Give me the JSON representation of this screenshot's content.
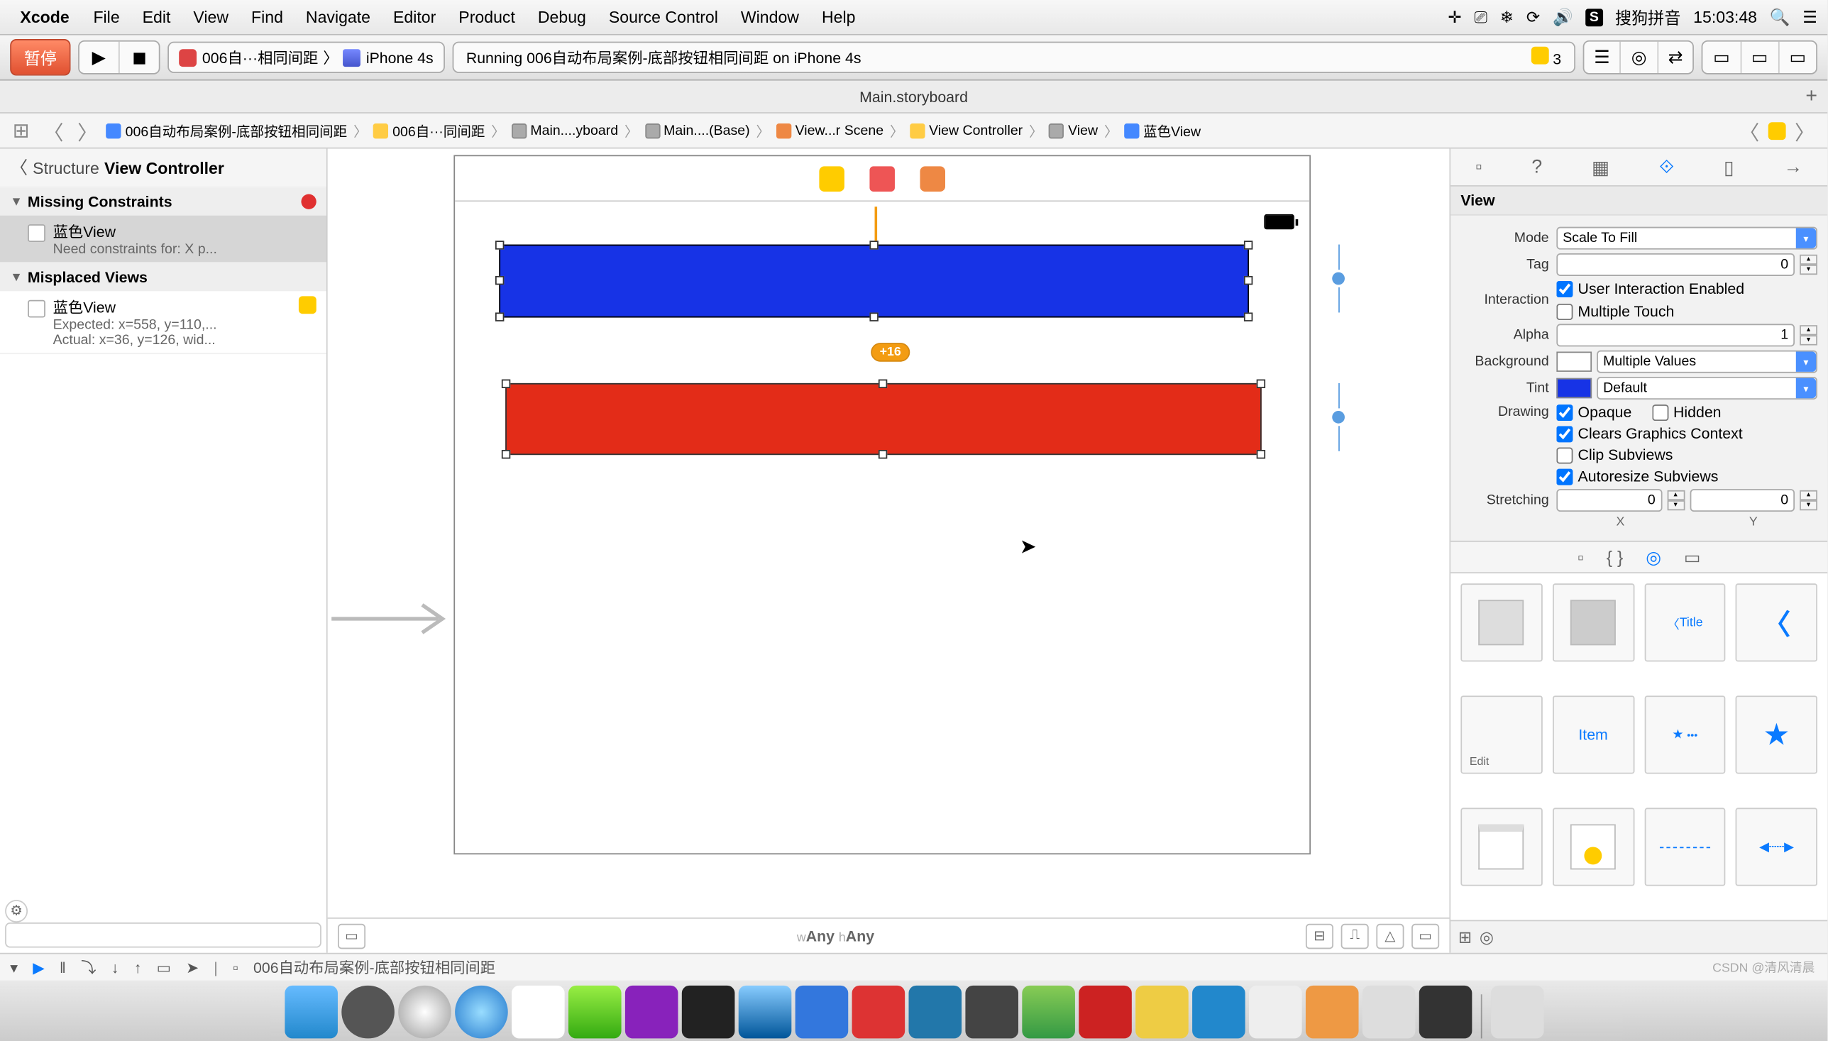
{
  "menubar": {
    "app": "Xcode",
    "items": [
      "File",
      "Edit",
      "View",
      "Find",
      "Navigate",
      "Editor",
      "Product",
      "Debug",
      "Source Control",
      "Window",
      "Help"
    ],
    "ime_badge": "S",
    "ime_name": "搜狗拼音",
    "clock": "15:03:48"
  },
  "toolbar": {
    "stop_label": "暂停",
    "scheme_name": "006自···相同间距",
    "scheme_sep": "〉",
    "device_name": "iPhone 4s",
    "status_text": "Running 006自动布局案例-底部按钮相同间距 on iPhone 4s",
    "warning_count": "3"
  },
  "tab": {
    "title": "Main.storyboard"
  },
  "jumpbar": {
    "crumbs": [
      "006自动布局案例-底部按钮相同间距",
      "006自···同间距",
      "Main....yboard",
      "Main....(Base)",
      "View...r Scene",
      "View Controller",
      "View",
      "蓝色View"
    ]
  },
  "outline": {
    "header_structure": "Structure",
    "header_vc": "View Controller",
    "sec1": "Missing Constraints",
    "item1_title": "蓝色View",
    "item1_sub": "Need constraints for: X p...",
    "sec2": "Misplaced Views",
    "item2_title": "蓝色View",
    "item2_sub1": "Expected: x=558, y=110,...",
    "item2_sub2": "Actual: x=36, y=126, wid..."
  },
  "canvas": {
    "constraint_badge": "+16",
    "size_w_prefix": "w",
    "size_w": "Any",
    "size_h_prefix": "h",
    "size_h": "Any"
  },
  "inspector": {
    "section": "View",
    "mode_label": "Mode",
    "mode_value": "Scale To Fill",
    "tag_label": "Tag",
    "tag_value": "0",
    "interaction_label": "Interaction",
    "interaction_uie": "User Interaction Enabled",
    "interaction_mt": "Multiple Touch",
    "alpha_label": "Alpha",
    "alpha_value": "1",
    "bg_label": "Background",
    "bg_value": "Multiple Values",
    "tint_label": "Tint",
    "tint_value": "Default",
    "drawing_label": "Drawing",
    "drawing_opaque": "Opaque",
    "drawing_hidden": "Hidden",
    "drawing_cgc": "Clears Graphics Context",
    "drawing_clip": "Clip Subviews",
    "drawing_auto": "Autoresize Subviews",
    "stretching_label": "Stretching",
    "stretch_x": "0",
    "stretch_x_lbl": "X",
    "stretch_y": "0",
    "stretch_y_lbl": "Y"
  },
  "library": {
    "items": [
      "",
      "",
      "Title",
      "",
      "Edit",
      "Item",
      "",
      "",
      "",
      " ",
      "",
      ""
    ]
  },
  "debugbar": {
    "path": "006自动布局案例-底部按钮相同间距"
  },
  "watermark": "CSDN @清风清晨"
}
